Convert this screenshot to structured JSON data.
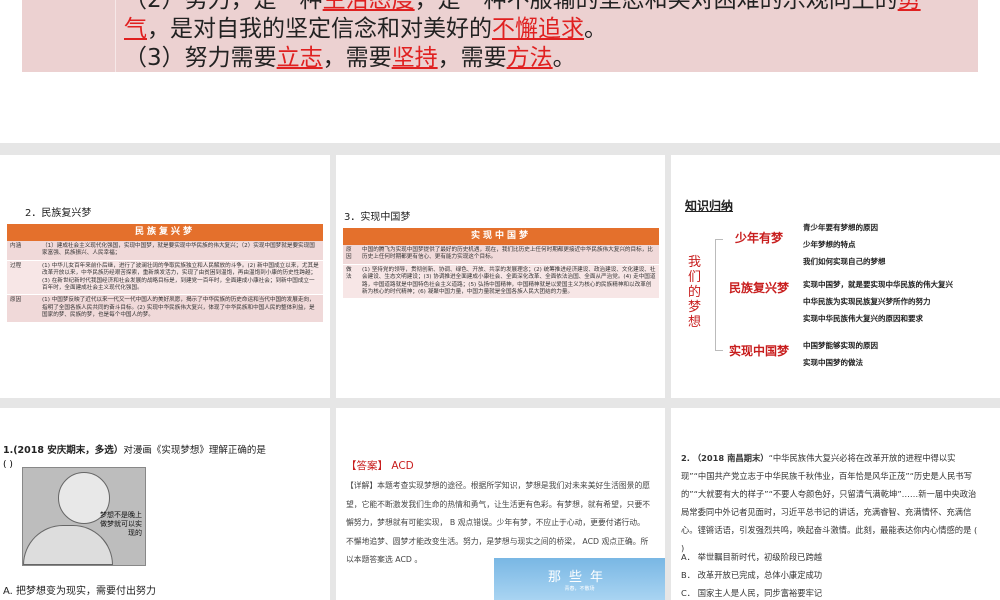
{
  "slide_top": {
    "line1_pre": "（2）努力，是一种",
    "line1_u1": "生活态度",
    "line1_mid": "，是一种不服输的坚忍和笑对困难的乐观向上的",
    "line1_u2": "勇",
    "line2_u1": "气",
    "line2_mid": "，是对自我的坚定信念和对美好的",
    "line2_u2": "不懈追求",
    "line2_end": "。",
    "line3_pre": "（3）努力需要",
    "line3_u1": "立志",
    "line3_m1": "，需要",
    "line3_u2": "坚持",
    "line3_m2": "，需要",
    "line3_u3": "方法",
    "line3_end": "。"
  },
  "slide_fuxing": {
    "title": "2．民族复兴梦",
    "header": "民族复兴梦",
    "rows": [
      {
        "label": "内涵",
        "text": "（1）建成社会主义现代化强国，实现中国梦，就是要实现中华民族的伟大复兴；（2）实现中国梦就是要实现国家富强、民族振兴、人民幸福；"
      },
      {
        "label": "过程",
        "text": "(1) 中华儿女百年来前仆后继，进行了波澜壮阔的争取民族独立和人民解放的斗争。(2) 新中国成立以来，尤其是改革开放以来，中华民族历经艰苦探索，重新焕发活力，实现了由贫困到温饱，再由温饱到小康的历史性跨越；(3) 在新世纪新时代我国经济和社会发展的战略目标是，到建党一百年时，全面建成小康社会；到新中国成立一百年时，全面建成社会主义现代化强国。"
      },
      {
        "label": "原因",
        "text": "(1) 中国梦反映了近代以来一代又一代中国人的美好夙愿，揭示了中华民族的历史命运和当代中国的发展走向，指明了全国各族人民共同的奋斗目标。(2) 实现中华民族伟大复兴，体现了中华民族和中国人民的整体利益，是国家的梦、民族的梦，也是每个中国人的梦。"
      }
    ]
  },
  "slide_shixian": {
    "title": "3．实现中国梦",
    "header": "实现中国梦",
    "rows": [
      {
        "label": "原因",
        "text": "中国的腾飞为实现中国梦提供了最好的历史机遇，现在，我们比历史上任何时期都更接近中华民族伟大复兴的目标，比历史上任何时期都更有信心、更有能力实现这个目标。"
      },
      {
        "label": "做法",
        "text": "(1) 坚持党的领导，贯彻创新、协调、绿色、开放、共享的发展理念；(2) 统筹推进经济建设、政治建设、文化建设、社会建设、生态文明建设；(3) 协调推进全面建成小康社会、全面深化改革、全面依法治国、全面从严治党。(4) 走中国道路，中国道路就是中国特色社会主义道路；(5) 弘扬中国精神，中国精神就是以爱国主义为核心的民族精神和以改革创新为核心的时代精神；(6) 凝聚中国力量，中国力量就是全国各族人民大团结的力量。"
      }
    ]
  },
  "slide_summary": {
    "title": "知识归纳",
    "root": "我们的梦想",
    "groups": [
      {
        "name": "少年有梦",
        "items": [
          "青少年要有梦想的原因",
          "少年梦想的特点",
          "我们如何实现自己的梦想"
        ]
      },
      {
        "name": "民族复兴梦",
        "items": [
          "实现中国梦，就是要实现中华民族的伟大复兴",
          "中华民族为实现民族复兴梦所作的努力",
          "实现中华民族伟大复兴的原因和要求"
        ]
      },
      {
        "name": "实现中国梦",
        "items": [
          "中国梦能够实现的原因",
          "实现中国梦的做法"
        ]
      }
    ]
  },
  "slide_q1": {
    "question_bold": "1.(2018 安庆期末，多选）",
    "question": "对漫画《实现梦想》理解正确的是",
    "paren": "(      )",
    "cartoon_caption": "梦想不是晚上做梦就可以实现的",
    "option_a": "A. 把梦想变为现实，需要付出努力"
  },
  "slide_answer": {
    "answer_label": "【答案】",
    "answer": "ACD",
    "detail": "【详解】本题考查实现梦想的途径。根据所学知识，梦想是我们对未来美好生活图景的愿望，它能不断激发我们生命的热情和勇气，让生活更有色彩。有梦想，就有希望，只要不懈努力，梦想就有可能实现， B 观点错误。少年有梦，不应止于心动，更要付诸行动。不懈地追梦、圆梦才能改变生活。努力，是梦想与现实之间的桥梁， ACD 观点正确。所以本题答案选 ACD 。",
    "image_title": "那些年",
    "image_sub": "青春，不散场"
  },
  "slide_q2": {
    "question_bold": "2. （2018 南昌期末）",
    "question": "“中华民族伟大复兴必将在改革开放的进程中得以实现”“中国共产党立志于中华民族千秋伟业，百年恰是风华正茂”“历史是人民书写的”“大就要有大的样子”“不要人夸颜色好，只留清气满乾坤”……新一届中央政治局常委同中外记者见面时，习近平总书记的讲话，充满睿智、充满情怀、充满信心。铿锵话语，引发强烈共鸣，唤起奋斗激情。此刻，最能表达你内心情感的是 (      )",
    "options": [
      "A． 举世瞩目新时代，初级阶段已跨越",
      "B． 改革开放已完成，总体小康定成功",
      "C． 国家主人是人民，同步富裕要牢记"
    ]
  }
}
